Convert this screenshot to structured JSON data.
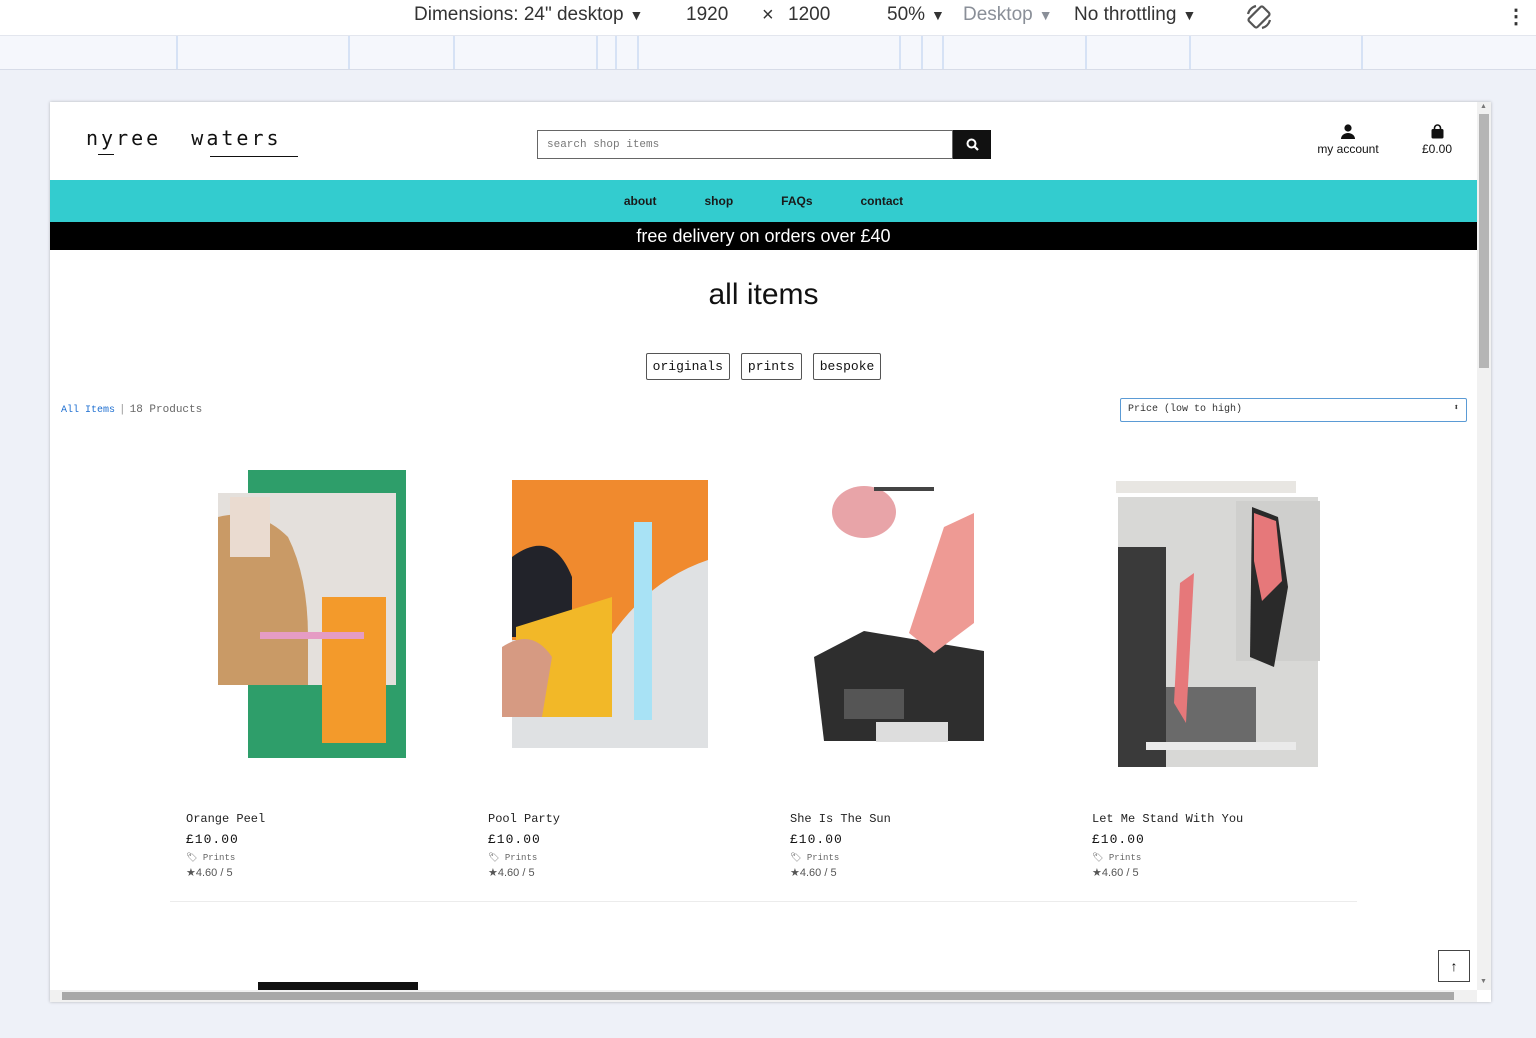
{
  "devtools": {
    "dimensions_label": "Dimensions: 24\" desktop",
    "width": "1920",
    "times": "×",
    "height": "1200",
    "zoom": "50%",
    "device": "Desktop",
    "throttling": "No throttling"
  },
  "header": {
    "logo": "nyree  waters",
    "search_placeholder": "search shop items",
    "account_label": "my account",
    "cart_total": "£0.00"
  },
  "nav": {
    "items": [
      "about",
      "shop",
      "FAQs",
      "contact"
    ]
  },
  "promo": "free delivery on orders over £40",
  "main": {
    "title": "all items",
    "categories": [
      "originals",
      "prints",
      "bespoke"
    ],
    "breadcrumb": {
      "link": "All Items",
      "separator": "|",
      "count": "18 Products"
    },
    "sort": "Price (low to high)"
  },
  "products": [
    {
      "name": "Orange Peel",
      "price": "£10.00",
      "tag": "Prints",
      "rating": "4.60 / 5"
    },
    {
      "name": "Pool Party",
      "price": "£10.00",
      "tag": "Prints",
      "rating": "4.60 / 5"
    },
    {
      "name": "She Is The Sun",
      "price": "£10.00",
      "tag": "Prints",
      "rating": "4.60 / 5"
    },
    {
      "name": "Let Me Stand With You",
      "price": "£10.00",
      "tag": "Prints",
      "rating": "4.60 / 5"
    }
  ],
  "colors": {
    "nav_bg": "#33cccf",
    "promo_bg": "#000000",
    "link": "#1e6fd1"
  }
}
